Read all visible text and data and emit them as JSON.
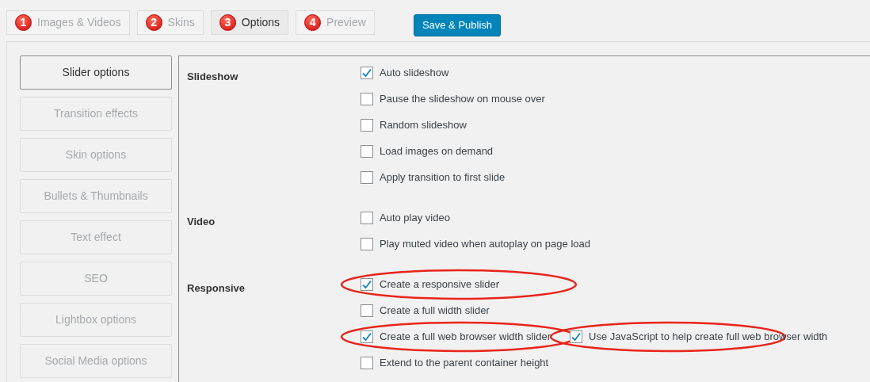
{
  "tabs": [
    {
      "number": "1",
      "label": "Images & Videos",
      "selected": false
    },
    {
      "number": "2",
      "label": "Skins",
      "selected": false
    },
    {
      "number": "3",
      "label": "Options",
      "selected": true
    },
    {
      "number": "4",
      "label": "Preview",
      "selected": false
    }
  ],
  "save_button": "Save & Publish",
  "sidebar": {
    "items": [
      {
        "label": "Slider options",
        "selected": true
      },
      {
        "label": "Transition effects",
        "selected": false
      },
      {
        "label": "Skin options",
        "selected": false
      },
      {
        "label": "Bullets & Thumbnails",
        "selected": false
      },
      {
        "label": "Text effect",
        "selected": false
      },
      {
        "label": "SEO",
        "selected": false
      },
      {
        "label": "Lightbox options",
        "selected": false
      },
      {
        "label": "Social Media options",
        "selected": false
      }
    ]
  },
  "sections": [
    {
      "title": "Slideshow",
      "options": [
        {
          "label": "Auto slideshow",
          "checked": true,
          "circled": false
        },
        {
          "label": "Pause the slideshow on mouse over",
          "checked": false,
          "circled": false
        },
        {
          "label": "Random slideshow",
          "checked": false,
          "circled": false
        },
        {
          "label": "Load images on demand",
          "checked": false,
          "circled": false
        },
        {
          "label": "Apply transition to first slide",
          "checked": false,
          "circled": false
        }
      ]
    },
    {
      "title": "Video",
      "options": [
        {
          "label": "Auto play video",
          "checked": false,
          "circled": false
        },
        {
          "label": "Play muted video when autoplay on page load",
          "checked": false,
          "circled": false
        }
      ]
    },
    {
      "title": "Responsive",
      "options": [
        {
          "label": "Create a responsive slider",
          "checked": true,
          "circled": true
        },
        {
          "label": "Create a full width slider",
          "checked": false,
          "circled": false
        },
        {
          "label": "Create a full web browser width slider",
          "checked": true,
          "circled": true,
          "side_option": {
            "label": "Use JavaScript to help create full web browser width",
            "checked": true,
            "circled": true
          }
        },
        {
          "label": "Extend to the parent container height",
          "checked": false,
          "circled": false
        }
      ]
    }
  ]
}
